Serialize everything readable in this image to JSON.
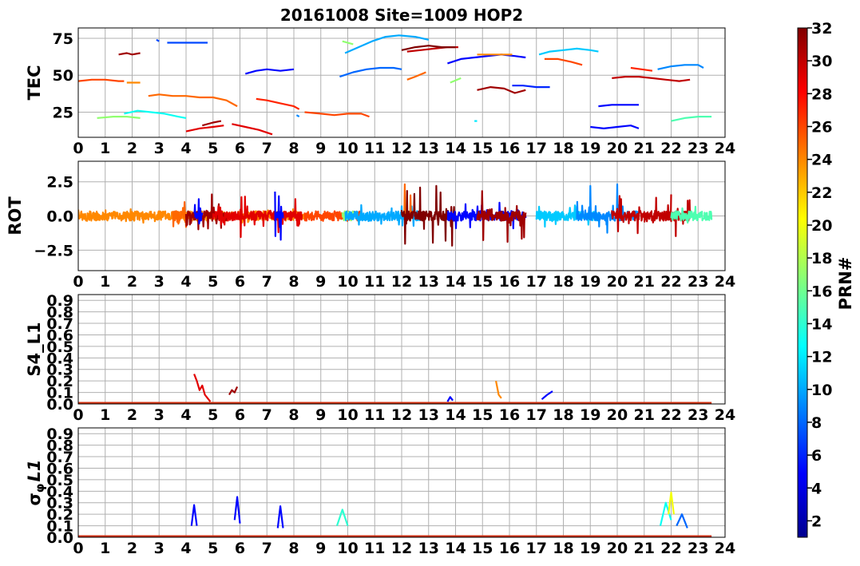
{
  "chart_data": {
    "title": "20161008 Site=1009 HOP2",
    "x_ticks": [
      "0",
      "1",
      "2",
      "3",
      "4",
      "5",
      "6",
      "7",
      "8",
      "9",
      "10",
      "11",
      "12",
      "13",
      "14",
      "15",
      "16",
      "17",
      "18",
      "19",
      "20",
      "21",
      "22",
      "23",
      "24"
    ],
    "xlim": [
      0,
      24
    ],
    "grid": true,
    "colormap": "jet",
    "panels": [
      {
        "name": "TEC",
        "type": "line",
        "ylabel": "TEC",
        "ylim": [
          8,
          82
        ],
        "y_ticks": [
          "25",
          "50",
          "75"
        ],
        "y_tick_values": [
          25,
          50,
          75
        ],
        "series": [
          {
            "prn": 26,
            "x": [
              0.0,
              0.5,
              1.0,
              1.5,
              1.7
            ],
            "y": [
              46,
              47,
              47,
              46,
              46
            ]
          },
          {
            "prn": 24,
            "x": [
              1.8,
              2.3
            ],
            "y": [
              45,
              45
            ]
          },
          {
            "prn": 31,
            "x": [
              1.5,
              1.8,
              2.0,
              2.3
            ],
            "y": [
              64,
              65,
              64,
              65
            ]
          },
          {
            "prn": 17,
            "x": [
              0.7,
              1.3,
              1.8,
              2.3
            ],
            "y": [
              21,
              22,
              22,
              21
            ]
          },
          {
            "prn": 13,
            "x": [
              1.7,
              2.2,
              2.7,
              3.2,
              3.7,
              4.0
            ],
            "y": [
              24,
              26,
              25,
              24,
              22,
              21
            ]
          },
          {
            "prn": 25,
            "x": [
              2.6,
              3.0,
              3.5,
              4.0,
              4.5,
              5.0,
              5.5,
              5.9
            ],
            "y": [
              36,
              37,
              36,
              36,
              35,
              35,
              33,
              29
            ]
          },
          {
            "prn": 7,
            "x": [
              2.9,
              3.0
            ],
            "y": [
              74,
              73
            ]
          },
          {
            "prn": 7,
            "x": [
              3.3,
              3.8,
              4.3,
              4.8
            ],
            "y": [
              72,
              72,
              72,
              72
            ]
          },
          {
            "prn": 29,
            "x": [
              4.0,
              4.5,
              5.0,
              5.4
            ],
            "y": [
              12,
              14,
              15,
              16
            ]
          },
          {
            "prn": 31,
            "x": [
              4.6,
              5.0,
              5.3
            ],
            "y": [
              16,
              18,
              19
            ]
          },
          {
            "prn": 29,
            "x": [
              5.7,
              6.2,
              6.7,
              7.2
            ],
            "y": [
              17,
              15,
              13,
              10
            ]
          },
          {
            "prn": 27,
            "x": [
              6.6,
              7.0,
              7.5,
              8.0,
              8.2
            ],
            "y": [
              34,
              33,
              31,
              29,
              27
            ]
          },
          {
            "prn": 5,
            "x": [
              6.2,
              6.6,
              7.0,
              7.5,
              8.0
            ],
            "y": [
              51,
              53,
              54,
              53,
              54
            ]
          },
          {
            "prn": 26,
            "x": [
              8.4,
              9.0,
              9.5,
              10.0,
              10.5,
              10.8
            ],
            "y": [
              25,
              24,
              23,
              24,
              24,
              22
            ]
          },
          {
            "prn": 9,
            "x": [
              8.1,
              8.2
            ],
            "y": [
              23,
              22
            ]
          },
          {
            "prn": 8,
            "x": [
              9.7,
              10.2,
              10.7,
              11.2,
              11.7,
              12.0
            ],
            "y": [
              49,
              52,
              54,
              55,
              55,
              54
            ]
          },
          {
            "prn": 17,
            "x": [
              9.8,
              10.2
            ],
            "y": [
              73,
              71
            ]
          },
          {
            "prn": 10,
            "x": [
              9.9,
              10.4,
              10.9,
              11.4,
              11.9,
              12.5,
              13.0
            ],
            "y": [
              65,
              69,
              73,
              76,
              77,
              76,
              74
            ]
          },
          {
            "prn": 30,
            "x": [
              12.2,
              12.7,
              13.2,
              13.7,
              14.1
            ],
            "y": [
              66,
              67,
              68,
              69,
              69
            ]
          },
          {
            "prn": 32,
            "x": [
              12.0,
              12.5,
              13.0,
              13.5,
              14.0
            ],
            "y": [
              67,
              69,
              70,
              69,
              69
            ]
          },
          {
            "prn": 25,
            "x": [
              12.2,
              12.5,
              12.9
            ],
            "y": [
              47,
              49,
              52
            ]
          },
          {
            "prn": 17,
            "x": [
              13.8,
              14.2
            ],
            "y": [
              45,
              48
            ]
          },
          {
            "prn": 5,
            "x": [
              13.7,
              14.2,
              14.7,
              15.2,
              15.7,
              16.2,
              16.6
            ],
            "y": [
              58,
              61,
              62,
              63,
              64,
              63,
              62
            ]
          },
          {
            "prn": 24,
            "x": [
              14.8,
              15.3,
              15.8,
              16.1
            ],
            "y": [
              64,
              64,
              64,
              64
            ]
          },
          {
            "prn": 31,
            "x": [
              14.8,
              15.3,
              15.8,
              16.2,
              16.6
            ],
            "y": [
              40,
              42,
              41,
              38,
              40
            ]
          },
          {
            "prn": 6,
            "x": [
              16.1,
              16.5,
              17.0,
              17.5
            ],
            "y": [
              43,
              43,
              42,
              42
            ]
          },
          {
            "prn": 11,
            "x": [
              17.1,
              17.5,
              18.0,
              18.5,
              19.0,
              19.3
            ],
            "y": [
              64,
              66,
              67,
              68,
              67,
              66
            ]
          },
          {
            "prn": 26,
            "x": [
              17.3,
              17.8,
              18.3,
              18.7
            ],
            "y": [
              61,
              61,
              59,
              57
            ]
          },
          {
            "prn": 12,
            "x": [
              14.7,
              14.8
            ],
            "y": [
              19,
              19
            ]
          },
          {
            "prn": 5,
            "x": [
              19.0,
              19.5,
              20.0,
              20.5,
              20.8
            ],
            "y": [
              15,
              14,
              15,
              16,
              14
            ]
          },
          {
            "prn": 5,
            "x": [
              19.3,
              19.8,
              20.3,
              20.8
            ],
            "y": [
              29,
              30,
              30,
              30
            ]
          },
          {
            "prn": 30,
            "x": [
              19.8,
              20.3,
              20.8,
              21.3,
              21.8,
              22.3,
              22.7
            ],
            "y": [
              48,
              49,
              49,
              48,
              47,
              46,
              47
            ]
          },
          {
            "prn": 27,
            "x": [
              20.5,
              20.9,
              21.3
            ],
            "y": [
              55,
              54,
              53
            ]
          },
          {
            "prn": 9,
            "x": [
              21.5,
              22.0,
              22.5,
              23.0,
              23.2
            ],
            "y": [
              54,
              56,
              57,
              57,
              55
            ]
          },
          {
            "prn": 15,
            "x": [
              22.0,
              22.5,
              23.0,
              23.5
            ],
            "y": [
              19,
              21,
              22,
              22
            ]
          }
        ]
      },
      {
        "name": "ROT",
        "type": "line",
        "ylabel": "ROT",
        "ylim": [
          -4,
          4
        ],
        "y_ticks": [
          "−2.5",
          "0.0",
          "2.5"
        ],
        "y_tick_values": [
          -2.5,
          0,
          2.5
        ],
        "series": [
          {
            "prn": 24,
            "x": [
              0.0,
              8.4
            ],
            "amplitude": 0.5
          },
          {
            "prn": 25,
            "x": [
              3.5,
              4.0
            ],
            "amplitude": 2.5
          },
          {
            "prn": 31,
            "x": [
              4.0,
              5.5
            ],
            "amplitude": 2.0
          },
          {
            "prn": 5,
            "x": [
              4.3,
              4.6
            ],
            "amplitude": 2.6
          },
          {
            "prn": 29,
            "x": [
              5.0,
              8.3
            ],
            "amplitude": 1.6
          },
          {
            "prn": 5,
            "x": [
              7.3,
              7.6
            ],
            "amplitude": 2.0
          },
          {
            "prn": 26,
            "x": [
              8.4,
              10.5
            ],
            "amplitude": 0.4
          },
          {
            "prn": 17,
            "x": [
              9.8,
              10.2
            ],
            "amplitude": 1.0
          },
          {
            "prn": 10,
            "x": [
              9.9,
              12.7
            ],
            "amplitude": 0.8
          },
          {
            "prn": 25,
            "x": [
              12.1,
              12.4
            ],
            "amplitude": 3.2
          },
          {
            "prn": 32,
            "x": [
              12.0,
              14.0
            ],
            "amplitude": 2.2
          },
          {
            "prn": 5,
            "x": [
              13.7,
              16.6
            ],
            "amplitude": 1.0
          },
          {
            "prn": 31,
            "x": [
              14.8,
              16.6
            ],
            "amplitude": 2.0
          },
          {
            "prn": 11,
            "x": [
              17.0,
              19.3
            ],
            "amplitude": 0.8
          },
          {
            "prn": 9,
            "x": [
              18.5,
              20.8
            ],
            "amplitude": 2.5
          },
          {
            "prn": 30,
            "x": [
              19.8,
              22.7
            ],
            "amplitude": 1.5
          },
          {
            "prn": 30,
            "x": [
              21.8,
              22.0
            ],
            "amplitude": 4.0
          },
          {
            "prn": 15,
            "x": [
              22.0,
              23.5
            ],
            "amplitude": 0.7
          }
        ]
      },
      {
        "name": "S4_L1",
        "type": "line",
        "ylabel": "S4_L1",
        "ylim": [
          0.0,
          0.95
        ],
        "y_ticks": [
          "0.0",
          "0.1",
          "0.2",
          "0.3",
          "0.4",
          "0.5",
          "0.6",
          "0.7",
          "0.8",
          "0.9"
        ],
        "y_tick_values": [
          0.0,
          0.1,
          0.2,
          0.3,
          0.4,
          0.5,
          0.6,
          0.7,
          0.8,
          0.9
        ],
        "baseline_x": [
          0.0,
          23.5
        ],
        "series": [
          {
            "prn": 29,
            "x": [
              4.3,
              4.4,
              4.5,
              4.6,
              4.7,
              4.8,
              4.9
            ],
            "y": [
              0.26,
              0.2,
              0.12,
              0.16,
              0.08,
              0.05,
              0.02
            ]
          },
          {
            "prn": 31,
            "x": [
              5.6,
              5.7,
              5.8,
              5.9
            ],
            "y": [
              0.08,
              0.12,
              0.1,
              0.15
            ]
          },
          {
            "prn": 5,
            "x": [
              13.7,
              13.8,
              13.9
            ],
            "y": [
              0.02,
              0.06,
              0.03
            ]
          },
          {
            "prn": 24,
            "x": [
              15.5,
              15.6,
              15.7
            ],
            "y": [
              0.2,
              0.08,
              0.05
            ]
          },
          {
            "prn": 5,
            "x": [
              17.2,
              17.4,
              17.6
            ],
            "y": [
              0.04,
              0.08,
              0.11
            ]
          }
        ]
      },
      {
        "name": "sigma_phi_L1",
        "type": "line",
        "ylabel": "σφL1",
        "ylim": [
          0.0,
          0.95
        ],
        "y_ticks": [
          "0.0",
          "0.1",
          "0.2",
          "0.3",
          "0.4",
          "0.5",
          "0.6",
          "0.7",
          "0.8",
          "0.9"
        ],
        "y_tick_values": [
          0.0,
          0.1,
          0.2,
          0.3,
          0.4,
          0.5,
          0.6,
          0.7,
          0.8,
          0.9
        ],
        "baseline_x": [
          0.0,
          23.5
        ],
        "series": [
          {
            "prn": 5,
            "x": [
              4.2,
              4.3,
              4.4
            ],
            "y": [
              0.1,
              0.28,
              0.1
            ]
          },
          {
            "prn": 5,
            "x": [
              5.8,
              5.9,
              6.0
            ],
            "y": [
              0.15,
              0.35,
              0.12
            ]
          },
          {
            "prn": 5,
            "x": [
              7.4,
              7.5,
              7.6
            ],
            "y": [
              0.08,
              0.27,
              0.08
            ]
          },
          {
            "prn": 14,
            "x": [
              9.6,
              9.8,
              10.0
            ],
            "y": [
              0.1,
              0.24,
              0.1
            ]
          },
          {
            "prn": 13,
            "x": [
              21.6,
              21.8,
              22.0
            ],
            "y": [
              0.1,
              0.3,
              0.15
            ]
          },
          {
            "prn": 20,
            "x": [
              21.9,
              22.0,
              22.1
            ],
            "y": [
              0.2,
              0.39,
              0.2
            ]
          },
          {
            "prn": 8,
            "x": [
              22.2,
              22.4,
              22.6
            ],
            "y": [
              0.1,
              0.2,
              0.08
            ]
          }
        ]
      }
    ],
    "colorbar": {
      "label": "PRN#",
      "range": [
        1,
        32
      ],
      "ticks": [
        "2",
        "4",
        "6",
        "8",
        "10",
        "12",
        "14",
        "16",
        "18",
        "20",
        "22",
        "24",
        "26",
        "28",
        "30",
        "32"
      ],
      "tick_values": [
        2,
        4,
        6,
        8,
        10,
        12,
        14,
        16,
        18,
        20,
        22,
        24,
        26,
        28,
        30,
        32
      ]
    }
  }
}
